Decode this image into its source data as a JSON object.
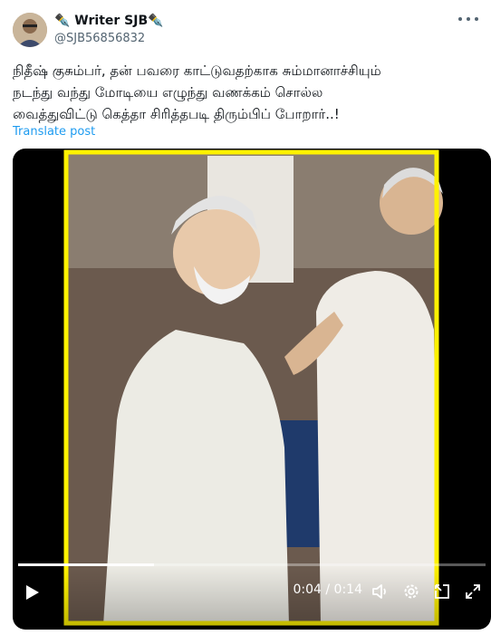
{
  "tweet": {
    "display_name": "✒️ Writer SJB✒️",
    "handle": "@SJB56856832",
    "text_lines": [
      "நிதீஷ் குசும்பர், தன் பவரை காட்டுவதற்காக சும்மானாச்சியும்",
      "நடந்து வந்து மோடியை எழுந்து வணக்கம் சொல்ல",
      "வைத்துவிட்டு கெத்தா சிரித்தபடி திரும்பிப் போறார்..!"
    ],
    "translate_label": "Translate post"
  },
  "video": {
    "current_time": "0:04",
    "separator": "/",
    "duration": "0:14",
    "progress": 0.29,
    "frame_border_color": "#fff200"
  },
  "icons": [
    "more-icon",
    "play-icon",
    "volume-icon",
    "settings-icon",
    "pip-icon",
    "fullscreen-icon"
  ],
  "colors": {
    "link": "#1d9bf0",
    "secondary_text": "#536471",
    "text": "#0f1419"
  }
}
